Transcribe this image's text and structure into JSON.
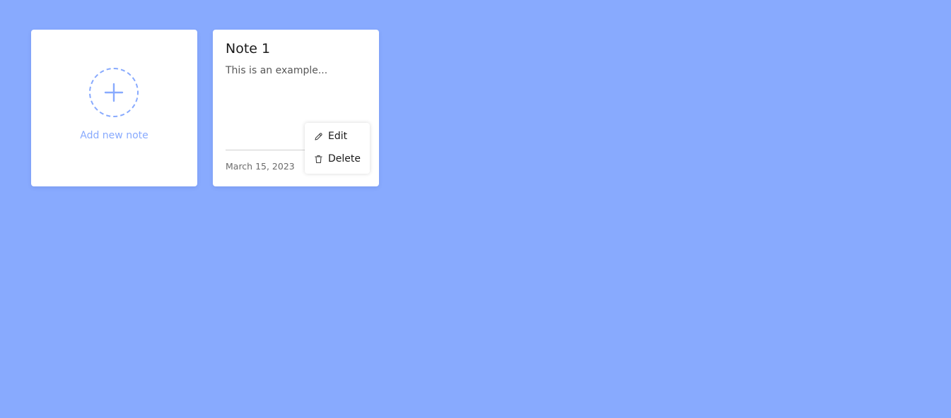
{
  "add_note": {
    "label": "Add new note",
    "icon": "plus-icon"
  },
  "notes": [
    {
      "title": "Note 1",
      "description": "This is an example...",
      "date": "March 15, 2023"
    }
  ],
  "context_menu": {
    "items": [
      {
        "label": "Edit",
        "icon": "pencil-icon"
      },
      {
        "label": "Delete",
        "icon": "trash-icon"
      }
    ]
  },
  "colors": {
    "background": "#88aafe",
    "card": "#ffffff",
    "accent": "#88aafe"
  }
}
